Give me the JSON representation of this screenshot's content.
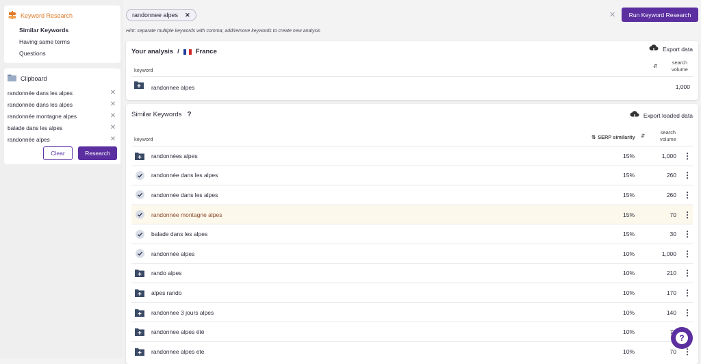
{
  "sidebar": {
    "section_title": "Keyword Research",
    "items": [
      {
        "label": "Similar Keywords",
        "active": true
      },
      {
        "label": "Having same terms",
        "active": false
      },
      {
        "label": "Questions",
        "active": false
      }
    ],
    "clipboard": {
      "title": "Clipboard",
      "entries": [
        "randonnée dans les alpes",
        "randonnée dans les alpes",
        "randonnée montagne alpes",
        "balade dans les alpes",
        "randonnée alpes"
      ],
      "clear_label": "Clear",
      "research_label": "Research"
    }
  },
  "search": {
    "chip_value": "randonnee alpes",
    "run_label": "Run Keyword Research",
    "hint": "Hint: separate multiple keywords with comma; add/remove keywords to create new analysis"
  },
  "analysis": {
    "title": "Your analysis",
    "separator": "/",
    "country": "France",
    "export_label": "Export data",
    "col_keyword": "keyword",
    "col_volume_1": "search",
    "col_volume_2": "volume",
    "row": {
      "keyword": "randonnee alpes",
      "volume": "1,000"
    }
  },
  "similar": {
    "title": "Similar Keywords",
    "help": "?",
    "export_label": "Export loaded data",
    "col_keyword": "keyword",
    "col_similarity": "SERP similarity",
    "col_volume_1": "search",
    "col_volume_2": "volume",
    "rows": [
      {
        "keyword": "randonnées alpes",
        "similarity": "15%",
        "volume": "1,000",
        "state": "add"
      },
      {
        "keyword": "randonnée dans les alpes",
        "similarity": "15%",
        "volume": "260",
        "state": "checked"
      },
      {
        "keyword": "randonnée dans les alpes",
        "similarity": "15%",
        "volume": "260",
        "state": "checked"
      },
      {
        "keyword": "randonnée montagne alpes",
        "similarity": "15%",
        "volume": "70",
        "state": "checked",
        "highlight": true
      },
      {
        "keyword": "balade dans les alpes",
        "similarity": "15%",
        "volume": "30",
        "state": "checked"
      },
      {
        "keyword": "randonnée alpes",
        "similarity": "10%",
        "volume": "1,000",
        "state": "checked"
      },
      {
        "keyword": "rando alpes",
        "similarity": "10%",
        "volume": "210",
        "state": "add"
      },
      {
        "keyword": "alpes rando",
        "similarity": "10%",
        "volume": "170",
        "state": "add"
      },
      {
        "keyword": "randonnee 3 jours alpes",
        "similarity": "10%",
        "volume": "140",
        "state": "add"
      },
      {
        "keyword": "randonnee alpes été",
        "similarity": "10%",
        "volume": "70",
        "state": "add"
      },
      {
        "keyword": "randonnee alpes ete",
        "similarity": "10%",
        "volume": "70",
        "state": "add"
      }
    ]
  },
  "colors": {
    "accent": "#5b2fa0",
    "orange": "#e07b2a",
    "highlight": "#fdf8ec"
  }
}
